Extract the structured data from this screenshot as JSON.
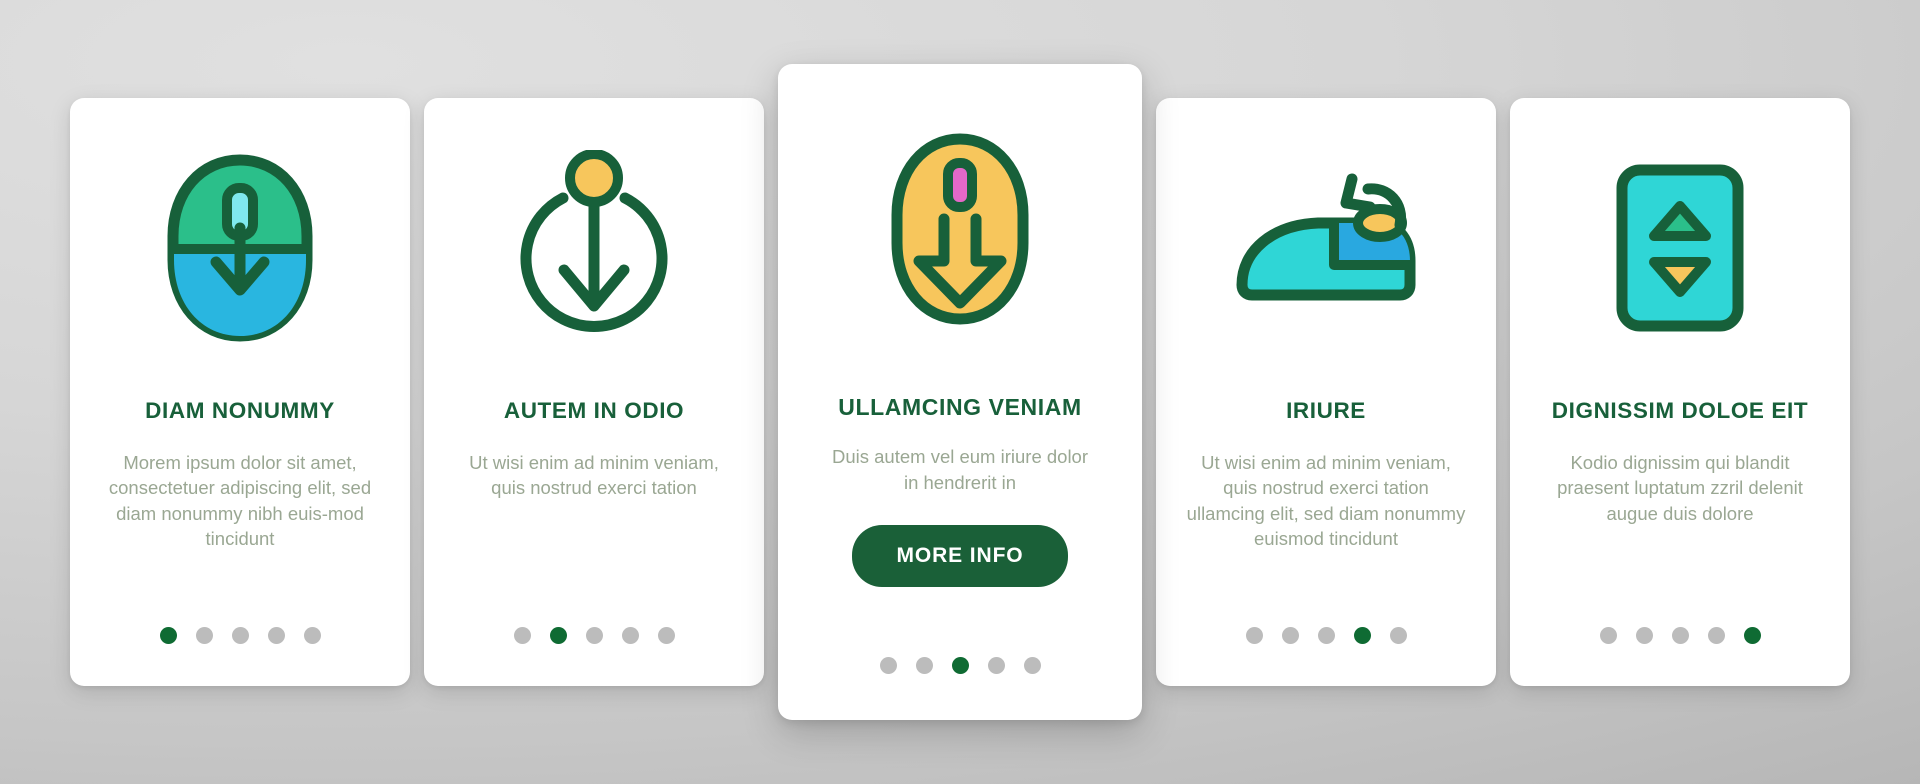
{
  "theme": {
    "background_top": "#e0e0e0",
    "background_bottom": "#b4b4b4",
    "card_bg": "#ffffff",
    "title_color": "#18603a",
    "body_color": "#9aa793",
    "accent_green": "#1a6038",
    "dot_active": "#0f6b33",
    "dot_inactive": "#bcbcbc",
    "icon_stroke": "#17603a",
    "icon_teal": "#2fd6d6",
    "icon_green": "#2bbf8a",
    "icon_blue": "#29b6e0",
    "icon_yellow": "#f7c65c",
    "icon_pink": "#e468c8",
    "icon_lightcyan": "#7fe9ee"
  },
  "cards": [
    {
      "id": "card-diam-nonummy",
      "icon_name": "mouse-scroll-down-icon",
      "title": "DIAM NONUMMY",
      "body": "Morem ipsum dolor sit amet, consectetuer adipiscing elit, sed diam nonummy nibh euis-mod tincidunt",
      "dots_total": 5,
      "dot_active_index": 0,
      "featured": false,
      "button_label": null
    },
    {
      "id": "card-autem-in-odio",
      "icon_name": "circle-arrow-down-icon",
      "title": "AUTEM IN ODIO",
      "body": "Ut wisi enim ad minim veniam, quis nostrud exerci tation",
      "dots_total": 5,
      "dot_active_index": 1,
      "featured": false,
      "button_label": null
    },
    {
      "id": "card-ullamcing-veniam",
      "icon_name": "mouse-arrow-down-icon",
      "title": "ULLAMCING VENIAM",
      "body": "Duis autem vel eum iriure dolor in hendrerit in",
      "dots_total": 5,
      "dot_active_index": 2,
      "featured": true,
      "button_label": "MORE INFO"
    },
    {
      "id": "card-iriure",
      "icon_name": "mouse-side-scroll-icon",
      "title": "IRIURE",
      "body": "Ut wisi enim ad minim veniam, quis nostrud exerci tation ullamcing elit, sed diam nonummy euismod tincidunt",
      "dots_total": 5,
      "dot_active_index": 3,
      "featured": false,
      "button_label": null
    },
    {
      "id": "card-dignissim-doloe-eit",
      "icon_name": "scroll-up-down-panel-icon",
      "title": "DIGNISSIM DOLOE EIT",
      "body": "Kodio dignissim qui blandit praesent luptatum zzril delenit augue duis dolore",
      "dots_total": 5,
      "dot_active_index": 4,
      "featured": false,
      "button_label": null
    }
  ]
}
